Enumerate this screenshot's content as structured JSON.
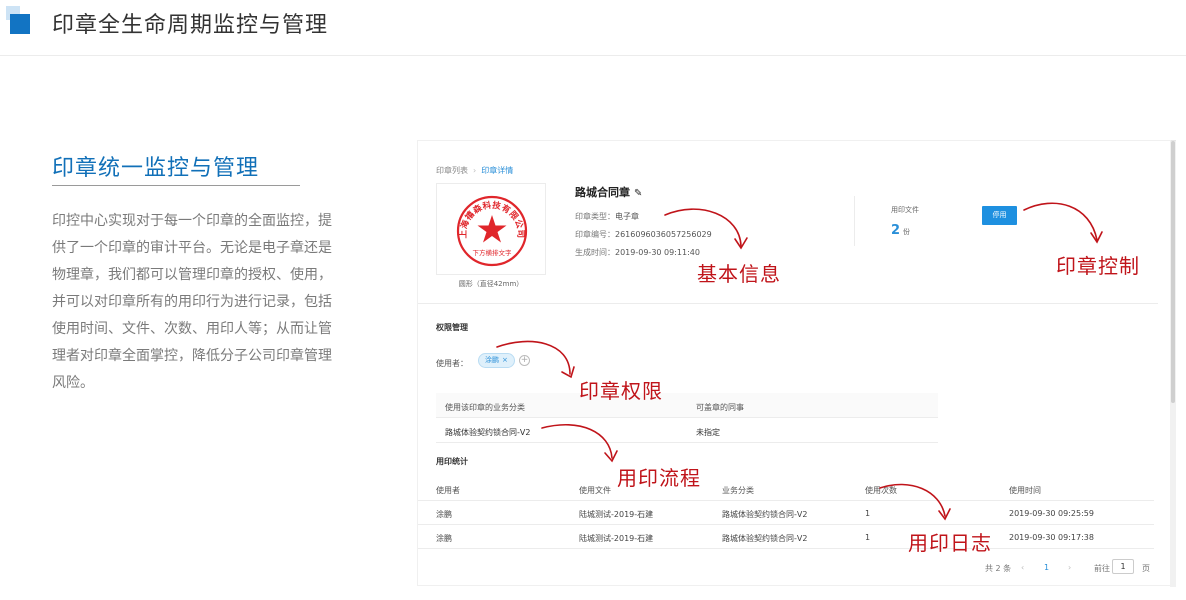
{
  "header": {
    "title": "印章全生命周期监控与管理"
  },
  "left": {
    "title": "印章统一监控与管理",
    "description": "印控中心实现对于每一个印章的全面监控，提供了一个印章的审计平台。无论是电子章还是物理章，我们都可以管理印章的授权、使用，并可以对印章所有的用印行为进行记录，包括使用时间、文件、次数、用印人等；从而让管理者对印章全面掌控，降低分子公司印章管理风险。"
  },
  "screenshot": {
    "breadcrumb": {
      "root": "印章列表",
      "separator": "›",
      "current": "印章详情"
    },
    "stamp": {
      "top_text": "上海禧森科技有限公司",
      "bottom_text": "下方横排文字",
      "caption": "圆形（直径42mm）",
      "color": "#e0262b"
    },
    "seal": {
      "name": "路城合同章",
      "edit_icon": "✎",
      "type_label": "印章类型：",
      "type_value": "电子章",
      "code_label": "印章编号：",
      "code_value": "2616096036057256029",
      "time_label": "生成时间：",
      "time_value": "2019-09-30 09:11:40"
    },
    "files": {
      "label": "用印文件",
      "count": "2",
      "unit": "份"
    },
    "disable_button": "停用",
    "permission": {
      "title": "权限管理",
      "user_label": "使用者：",
      "user_tag": "涂鹏",
      "tag_close": "×",
      "add_icon": "+",
      "table_headers": [
        "使用该印章的业务分类",
        "可盖章的同事"
      ],
      "table_row": [
        "路城体验契约锁合同-V2",
        "未指定"
      ]
    },
    "stats": {
      "title": "用印统计",
      "headers": [
        "使用者",
        "使用文件",
        "业务分类",
        "使用次数",
        "使用时间"
      ],
      "rows": [
        [
          "涂鹏",
          "陆城测试-2019-石建",
          "路城体验契约锁合同-V2",
          "1",
          "2019-09-30 09:25:59"
        ],
        [
          "涂鹏",
          "陆城测试-2019-石建",
          "路城体验契约锁合同-V2",
          "1",
          "2019-09-30 09:17:38"
        ]
      ]
    },
    "pagination": {
      "total": "共 2 条",
      "prev": "‹",
      "page": "1",
      "next": "›",
      "goto_label": "前往",
      "goto_value": "1",
      "goto_unit": "页"
    }
  },
  "annotations": {
    "basic_info": "基本信息",
    "seal_control": "印章控制",
    "seal_permission": "印章权限",
    "seal_flow": "用印流程",
    "seal_log": "用印日志",
    "color": "#c0141a"
  }
}
